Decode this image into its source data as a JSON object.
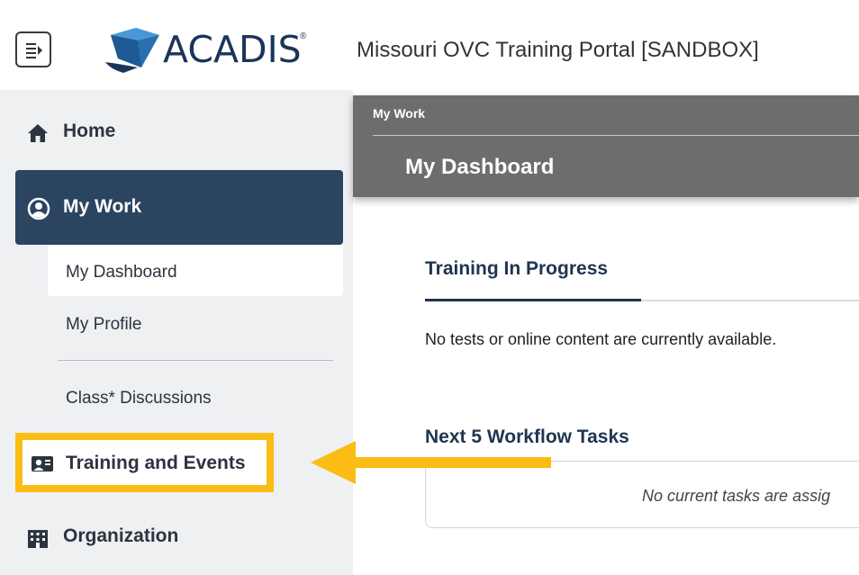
{
  "header": {
    "logo_text": "ACADIS",
    "logo_reg": "®",
    "portal_title": "Missouri OVC Training Portal [SANDBOX]"
  },
  "sidebar": {
    "home": "Home",
    "my_work": "My Work",
    "my_dashboard": "My Dashboard",
    "my_profile": "My Profile",
    "class_discussions": "Class* Discussions",
    "training_and_events": "Training and Events",
    "organization": "Organization"
  },
  "main": {
    "breadcrumb": "My Work",
    "page_title": "My Dashboard",
    "training_in_progress": {
      "title": "Training In Progress",
      "empty_text": "No tests or online content are currently available."
    },
    "workflow_tasks": {
      "title": "Next 5 Workflow Tasks",
      "empty_text": "No current tasks are assig"
    }
  },
  "colors": {
    "nav_active": "#2b4460",
    "highlight": "#fbbc14",
    "header_gray": "#6d6d6d",
    "logo_blue": "#1a3558"
  },
  "icons": {
    "menu": "collapse-menu-icon",
    "home": "home-icon",
    "my_work": "user-circle-icon",
    "training": "training-presenter-icon",
    "organization": "building-icon",
    "arrow": "arrow-left-icon"
  }
}
